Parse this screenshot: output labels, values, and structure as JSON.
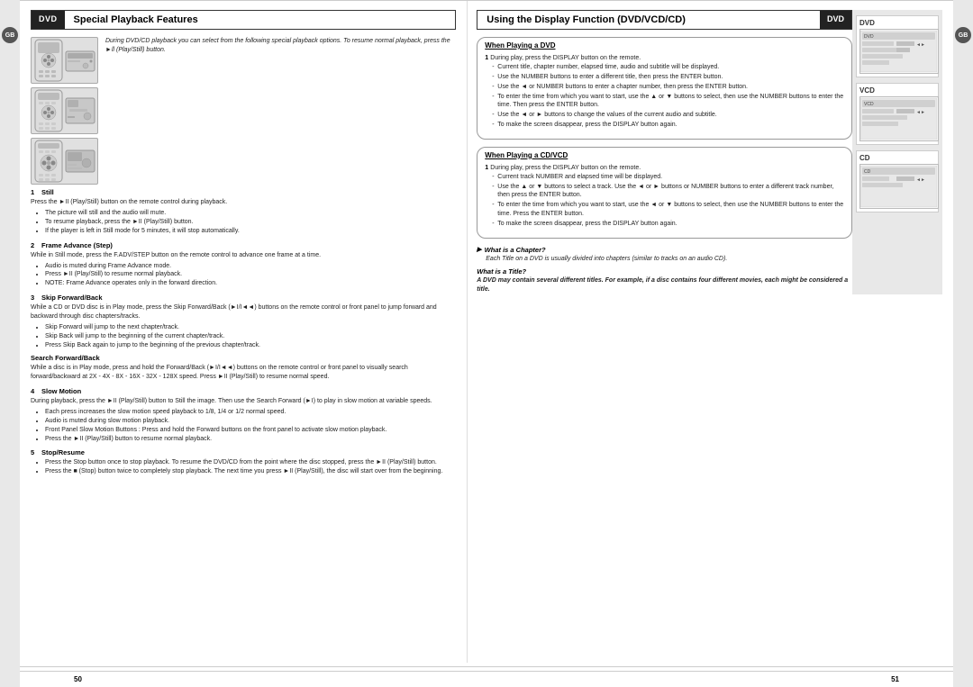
{
  "left": {
    "dvd_badge": "DVD",
    "title": "Special Playback Features",
    "gb_badge": "GB",
    "intro": "During DVD/CD playback you can select from the following special playback options. To resume normal playback, press the ►ll (Play/Still) button.",
    "items": [
      {
        "num": "1",
        "title": "Still",
        "body": "Press the ►II (Play/Still) button on the remote control during playback.",
        "bullets": [
          "The picture will still and the audio will mute.",
          "To resume playback, press the ►II (Play/Still) button.",
          "If the player is left in Still mode for 5 minutes, it will stop automatically."
        ]
      },
      {
        "num": "2",
        "title": "Frame Advance (Step)",
        "body": "While in Still mode, press the F.ADV/STEP button on the remote control to advance one frame at a time.",
        "bullets": [
          "Audio is muted during Frame Advance mode.",
          "Press ►II (Play/Still) to resume normal playback.",
          "NOTE: Frame Advance operates only in the forward direction."
        ]
      },
      {
        "num": "3",
        "title": "Skip Forward/Back",
        "body": "While a CD or DVD disc is in Play mode, press the Skip Forward/Back (►I/I◄◄) buttons on the remote control or front panel to jump forward and backward through disc chapters/tracks.",
        "bullets": [
          "Skip Forward will jump to the next chapter/track.",
          "Skip Back will jump to the beginning of the current chapter/track.",
          "Press Skip Back again to jump to the beginning of the previous chapter/track."
        ],
        "sub_title": "Search Forward/Back",
        "sub_body": "While a disc is in Play mode, press and hold the Forward/Back (►I/I◄◄) buttons on the remote control or front panel to visually search forward/backward at 2X - 4X - 8X - 16X - 32X - 128X speed. Press ►II (Play/Still) to resume normal speed."
      },
      {
        "num": "4",
        "title": "Slow Motion",
        "body": "During playback, press the ►II (Play/Still) button to Still the image. Then use the Search Forward (►I) to play in slow motion at variable speeds.",
        "bullets": [
          "Each press increases the slow motion speed playback to 1/8, 1/4 or 1/2 normal speed.",
          "Audio is muted during slow motion playback.",
          "Front Panel Slow Motion Buttons : Press and hold the Forward buttons on the front panel to activate slow motion playback.",
          "Press the ►II (Play/Still) button to resume normal playback."
        ]
      },
      {
        "num": "5",
        "title": "Stop/Resume",
        "bullets": [
          "Press the Stop button once to stop playback. To resume the DVD/CD from the point where the disc stopped, press the ►II (Play/Still) button.",
          "Press the ■ (Stop) button twice to completely stop playback. The next time you press ►II (Play/Still), the disc will start over from the beginning."
        ]
      }
    ]
  },
  "right": {
    "dvd_badge": "DVD",
    "gb_badge": "GB",
    "title": "Using the Display Function (DVD/VCD/CD)",
    "when_dvd": {
      "label": "When Playing a DVD",
      "steps": [
        {
          "num": "1",
          "text": "During play, press the DISPLAY button on the remote.",
          "bullets": [
            "Current title, chapter number, elapsed time, audio and subtitle will be displayed.",
            "Use the NUMBER buttons to enter a different title, then press the ENTER button.",
            "Use the ◄ or NUMBER buttons to enter a chapter number, then press the ENTER button.",
            "To enter the time from which you want to start, use the ▲ or ▼ buttons to select, then use the NUMBER buttons to enter the time. Then press the ENTER button.",
            "Use the ◄ or ► buttons to change the values of the current audio and subtitle.",
            "To make the screen disappear, press the DISPLAY button again."
          ]
        }
      ]
    },
    "when_cd_vcd": {
      "label": "When Playing a CD/VCD",
      "steps": [
        {
          "num": "1",
          "text": "During play, press the DISPLAY button on the remote.",
          "bullets": [
            "Current track NUMBER and elapsed time will be displayed.",
            "Use the ▲ or ▼ buttons to select a track. Use the ◄ or ► buttons or NUMBER buttons to enter a different track number, then press the ENTER button.",
            "To enter the time from which you want to start, use the ◄ or ▼ buttons to select, then use the NUMBER buttons to enter the time. Press the ENTER button.",
            "To make the screen disappear, press the DISPLAY button again."
          ]
        }
      ]
    },
    "what_chapter": {
      "label": "What is a Chapter?",
      "body": "Each Title on a DVD is usually divided into chapters (similar to tracks on an audio CD)."
    },
    "what_title": {
      "label": "What is a Title?",
      "body": "A DVD may contain several different titles. For example, if a disc contains four different movies, each might be considered a title."
    },
    "panels": [
      {
        "label": "DVD",
        "type": "dvd"
      },
      {
        "label": "VCD",
        "type": "vcd"
      },
      {
        "label": "CD",
        "type": "cd"
      }
    ]
  },
  "page_numbers": {
    "left": "50",
    "right": "51"
  }
}
